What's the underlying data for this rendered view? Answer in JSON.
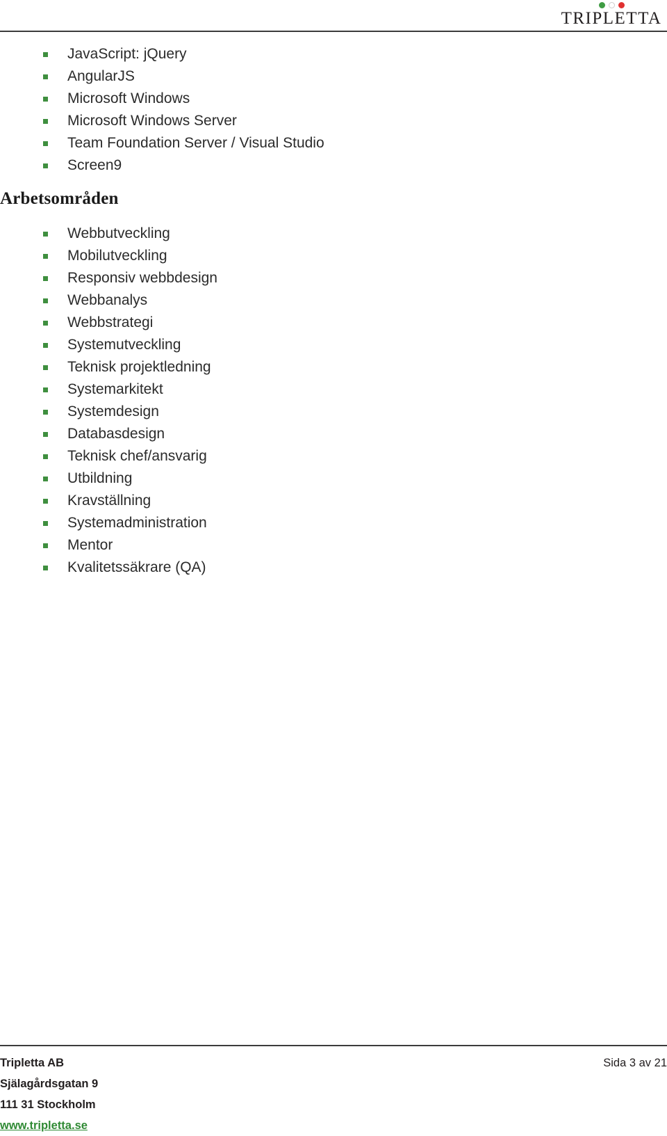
{
  "header": {
    "logo": {
      "wordmark": "TRIPLETTA",
      "dots": [
        {
          "name": "logo-dot-green",
          "color": "#3f9c43"
        },
        {
          "name": "logo-dot-white",
          "color": "#ffffff"
        },
        {
          "name": "logo-dot-red",
          "color": "#e03131"
        }
      ]
    }
  },
  "content": {
    "tech_list": {
      "items": [
        "JavaScript: jQuery",
        "AngularJS",
        "Microsoft Windows",
        "Microsoft Windows Server",
        "Team Foundation Server / Visual Studio",
        "Screen9"
      ]
    },
    "section": {
      "heading": "Arbetsområden",
      "items": [
        "Webbutveckling",
        "Mobilutveckling",
        "Responsiv webbdesign",
        "Webbanalys",
        "Webbstrategi",
        "Systemutveckling",
        "Teknisk projektledning",
        "Systemarkitekt",
        "Systemdesign",
        "Databasdesign",
        "Teknisk chef/ansvarig",
        "Utbildning",
        "Kravställning",
        "Systemadministration",
        "Mentor",
        "Kvalitetssäkrare (QA)"
      ]
    }
  },
  "footer": {
    "company": "Tripletta AB",
    "street": "Själagårdsgatan 9",
    "city": "111 31 Stockholm",
    "website": "www.tripletta.se",
    "page_number": "Sida 3 av 21"
  },
  "colors": {
    "bullet_green": "#3f8f3f",
    "link_green": "#2f8a34",
    "rule": "#3b3b3b",
    "text": "#2b2b2b"
  }
}
